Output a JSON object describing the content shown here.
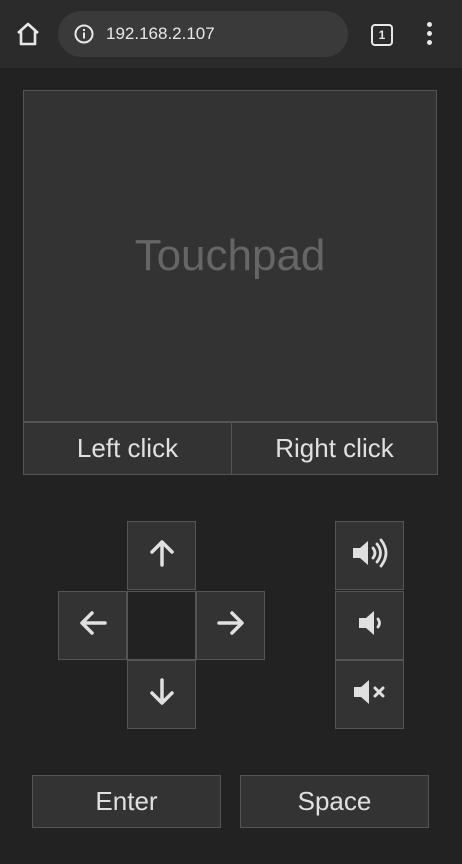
{
  "browser": {
    "url": "192.168.2.107",
    "tab_count": "1",
    "icons": [
      "home-icon",
      "info-icon",
      "tab-switcher-icon",
      "more-vert-icon"
    ]
  },
  "touchpad": {
    "label": "Touchpad",
    "left_click": "Left click",
    "right_click": "Right click"
  },
  "arrows": {
    "icons": [
      "arrow-up-icon",
      "arrow-left-icon",
      "arrow-right-icon",
      "arrow-down-icon"
    ]
  },
  "volume": {
    "icons": [
      "volume-up-icon",
      "volume-down-icon",
      "volume-mute-icon"
    ]
  },
  "keys": {
    "enter": "Enter",
    "space": "Space"
  },
  "colors": {
    "background": "#222222",
    "button": "#333333",
    "border": "#555555",
    "text": "#e0e0e0",
    "placeholder": "#666666"
  }
}
